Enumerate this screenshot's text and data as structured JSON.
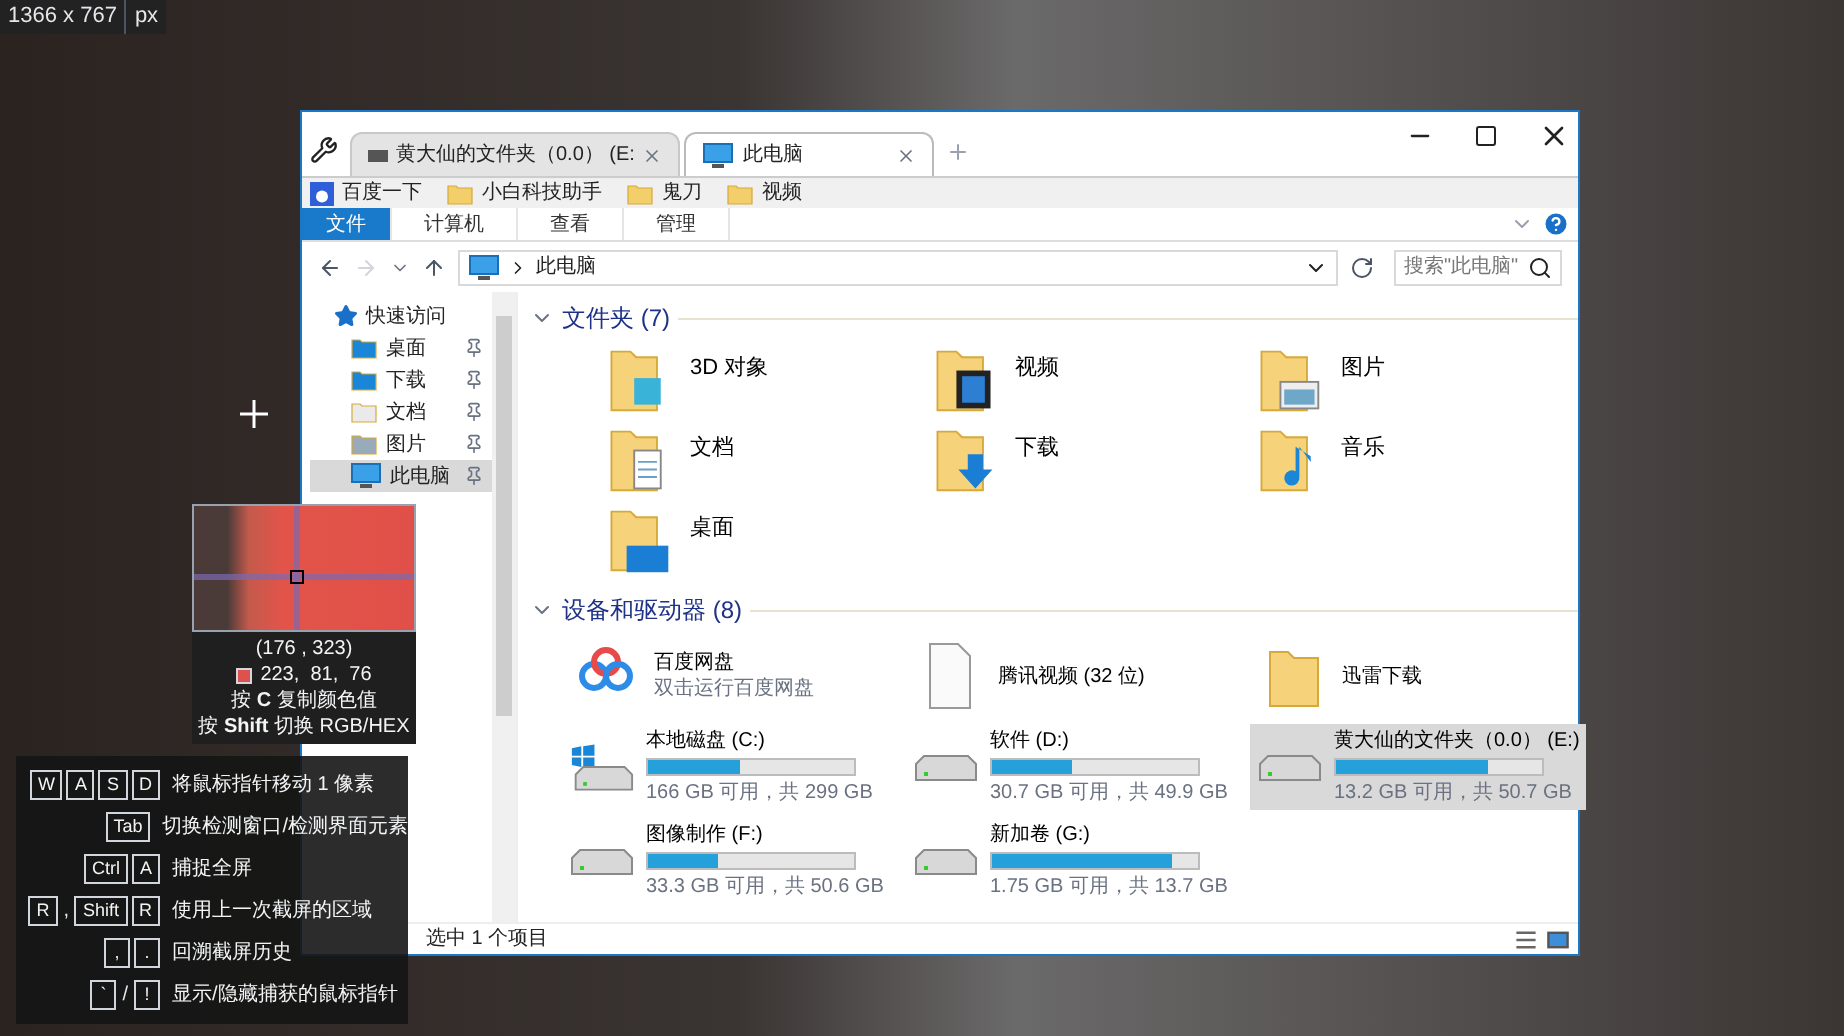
{
  "screen_size": {
    "value": "1366 x 767",
    "unit": "px"
  },
  "window": {
    "tabs": [
      {
        "label": "黄大仙的文件夹（0.0） (E:",
        "selected": false
      },
      {
        "label": "此电脑",
        "selected": true
      }
    ],
    "bookmarks": [
      "百度一下",
      "小白科技助手",
      "鬼刀",
      "视频"
    ],
    "ribbon_tabs": [
      {
        "label": "文件",
        "selected": true
      },
      {
        "label": "计算机",
        "selected": false
      },
      {
        "label": "查看",
        "selected": false
      },
      {
        "label": "管理",
        "selected": false
      }
    ],
    "address": "此电脑",
    "search": {
      "placeholder": "搜索\"此电脑\""
    },
    "nav": [
      {
        "label": "快速访问",
        "selected": false,
        "children": [
          {
            "label": "桌面",
            "selected": false
          },
          {
            "label": "下载",
            "selected": false
          },
          {
            "label": "文档",
            "selected": false
          },
          {
            "label": "图片",
            "selected": false
          },
          {
            "label": "此电脑",
            "selected": true
          }
        ]
      }
    ],
    "folders_header": "文件夹 (7)",
    "folders": [
      "3D 对象",
      "视频",
      "图片",
      "文档",
      "下载",
      "音乐",
      "桌面"
    ],
    "devices_header": "设备和驱动器 (8)",
    "devices": [
      {
        "kind": "app",
        "name": "百度网盘",
        "subtitle": "双击运行百度网盘",
        "selected": false
      },
      {
        "kind": "file",
        "name": "腾讯视频 (32 位)",
        "selected": false
      },
      {
        "kind": "folder",
        "name": "迅雷下载",
        "selected": false
      },
      {
        "kind": "drive",
        "name": "本地磁盘 (C:)",
        "level": 0.445,
        "reading": "166 GB 可用，共 299 GB",
        "selected": false
      },
      {
        "kind": "drive",
        "name": "软件 (D:)",
        "level": 0.385,
        "reading": "30.7 GB 可用，共 49.9 GB",
        "selected": false
      },
      {
        "kind": "drive",
        "name": "黄大仙的文件夹（0.0） (E:)",
        "level": 0.74,
        "reading": "13.2 GB 可用，共 50.7 GB",
        "selected": true
      },
      {
        "kind": "drive",
        "name": "图像制作 (F:)",
        "level": 0.34,
        "reading": "33.3 GB 可用，共 50.6 GB",
        "selected": false
      },
      {
        "kind": "drive",
        "name": "新加卷 (G:)",
        "level": 0.87,
        "reading": "1.75 GB 可用，共 13.7 GB",
        "selected": false
      }
    ],
    "status": "选中 1 个项目"
  },
  "magnifier": {
    "coords": "(176 , 323)",
    "color": "#df514c",
    "rgb": "223,  81,  76",
    "hints": [
      "按 **C** 复制颜色值",
      "按 **Shift** 切换 RGB/HEX"
    ]
  },
  "shortcuts": [
    {
      "keys": [
        {
          "kind": "key",
          "text": "W"
        },
        {
          "kind": "key",
          "text": "A"
        },
        {
          "kind": "key",
          "text": "S"
        },
        {
          "kind": "key",
          "text": "D"
        }
      ],
      "label": "将鼠标指针移动 1 像素"
    },
    {
      "keys": [
        {
          "kind": "key",
          "text": "Tab"
        }
      ],
      "label": "切换检测窗口/检测界面元素"
    },
    {
      "keys": [
        {
          "kind": "key",
          "text": "Ctrl"
        },
        {
          "kind": "key",
          "text": "A"
        }
      ],
      "label": "捕捉全屏"
    },
    {
      "keys": [
        {
          "kind": "key",
          "text": "R"
        },
        {
          "kind": "sep",
          "text": ","
        },
        {
          "kind": "key",
          "text": "Shift"
        },
        {
          "kind": "key",
          "text": "R"
        }
      ],
      "label": "使用上一次截屏的区域"
    },
    {
      "keys": [
        {
          "kind": "key",
          "text": ","
        },
        {
          "kind": "key",
          "text": "."
        }
      ],
      "label": "回溯截屏历史"
    },
    {
      "keys": [
        {
          "kind": "key",
          "text": "`"
        },
        {
          "kind": "sep",
          "text": "/"
        },
        {
          "kind": "key",
          "text": "!"
        }
      ],
      "label": "显示/隐藏捕获的鼠标指针"
    }
  ]
}
